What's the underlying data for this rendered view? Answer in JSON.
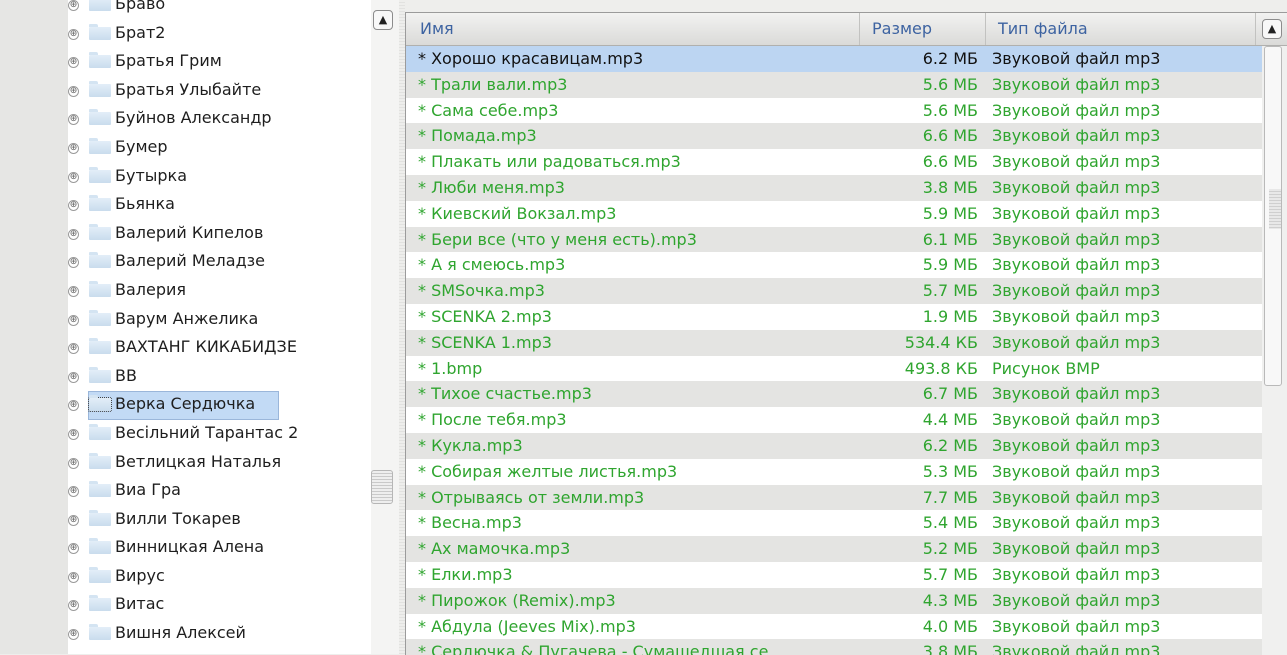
{
  "tree": {
    "items": [
      {
        "label": "Браво"
      },
      {
        "label": "Брат2"
      },
      {
        "label": "Братья Грим"
      },
      {
        "label": "Братья Улыбайте"
      },
      {
        "label": "Буйнов Александр"
      },
      {
        "label": "Бумер"
      },
      {
        "label": "Бутырка"
      },
      {
        "label": "Бьянка"
      },
      {
        "label": "Валерий Кипелов"
      },
      {
        "label": "Валерий Меладзе"
      },
      {
        "label": "Валерия"
      },
      {
        "label": "Варум Анжелика"
      },
      {
        "label": "ВАХТАНГ КИКАБИДЗЕ"
      },
      {
        "label": "ВВ"
      },
      {
        "label": "Верка Сердючка",
        "selected": true
      },
      {
        "label": "Весільний Тарантас 2"
      },
      {
        "label": "Ветлицкая Наталья"
      },
      {
        "label": "Виа Гра"
      },
      {
        "label": "Вилли Токарев"
      },
      {
        "label": "Винницкая Алена"
      },
      {
        "label": "Вирус"
      },
      {
        "label": "Витас"
      },
      {
        "label": "Вишня Алексей"
      }
    ],
    "expander_glyph": "⊕"
  },
  "file_list": {
    "columns": {
      "name": "Имя",
      "size": "Размер",
      "type": "Тип файла"
    },
    "rows": [
      {
        "name": "* Хорошо красавицам.mp3",
        "size": "6.2 МБ",
        "type": "Звуковой файл mp3",
        "selected": true
      },
      {
        "name": "* Трали вали.mp3",
        "size": "5.6 МБ",
        "type": "Звуковой файл mp3"
      },
      {
        "name": "* Сама себе.mp3",
        "size": "5.6 МБ",
        "type": "Звуковой файл mp3"
      },
      {
        "name": "* Помада.mp3",
        "size": "6.6 МБ",
        "type": "Звуковой файл mp3"
      },
      {
        "name": "* Плакать или радоваться.mp3",
        "size": "6.6 МБ",
        "type": "Звуковой файл mp3"
      },
      {
        "name": "* Люби меня.mp3",
        "size": "3.8 МБ",
        "type": "Звуковой файл mp3"
      },
      {
        "name": "* Киевский Вокзал.mp3",
        "size": "5.9 МБ",
        "type": "Звуковой файл mp3"
      },
      {
        "name": "* Бери все (что у меня есть).mp3",
        "size": "6.1 МБ",
        "type": "Звуковой файл mp3"
      },
      {
        "name": "* А я смеюсь.mp3",
        "size": "5.9 МБ",
        "type": "Звуковой файл mp3"
      },
      {
        "name": "* SMSочка.mp3",
        "size": "5.7 МБ",
        "type": "Звуковой файл mp3"
      },
      {
        "name": "* SCENKA 2.mp3",
        "size": "1.9 МБ",
        "type": "Звуковой файл mp3"
      },
      {
        "name": "* SCENKA 1.mp3",
        "size": "534.4 КБ",
        "type": "Звуковой файл mp3"
      },
      {
        "name": "* 1.bmp",
        "size": "493.8 КБ",
        "type": "Рисунок BMP"
      },
      {
        "name": "* Тихое счастье.mp3",
        "size": "6.7 МБ",
        "type": "Звуковой файл mp3"
      },
      {
        "name": "* После тебя.mp3",
        "size": "4.4 МБ",
        "type": "Звуковой файл mp3"
      },
      {
        "name": "* Кукла.mp3",
        "size": "6.2 МБ",
        "type": "Звуковой файл mp3"
      },
      {
        "name": "* Собирая желтые листья.mp3",
        "size": "5.3 МБ",
        "type": "Звуковой файл mp3"
      },
      {
        "name": "* Отрываясь от земли.mp3",
        "size": "7.7 МБ",
        "type": "Звуковой файл mp3"
      },
      {
        "name": "* Весна.mp3",
        "size": "5.4 МБ",
        "type": "Звуковой файл mp3"
      },
      {
        "name": "* Ах мамочка.mp3",
        "size": "5.2 МБ",
        "type": "Звуковой файл mp3"
      },
      {
        "name": "* Елки.mp3",
        "size": "5.7 МБ",
        "type": "Звуковой файл mp3"
      },
      {
        "name": "* Пирожок (Remix).mp3",
        "size": "4.3 МБ",
        "type": "Звуковой файл mp3"
      },
      {
        "name": "* Абдула (Jeeves Mix).mp3",
        "size": "4.0 МБ",
        "type": "Звуковой файл mp3"
      },
      {
        "name": "* Сердючка & Пугачева - Сумашедшая се",
        "size": "3.8 МБ",
        "type": "Звуковой файл mp3"
      }
    ]
  },
  "colors": {
    "file_text": "#2fa52f",
    "header_text": "#3d63a1",
    "selection": "#bcd5f2"
  }
}
